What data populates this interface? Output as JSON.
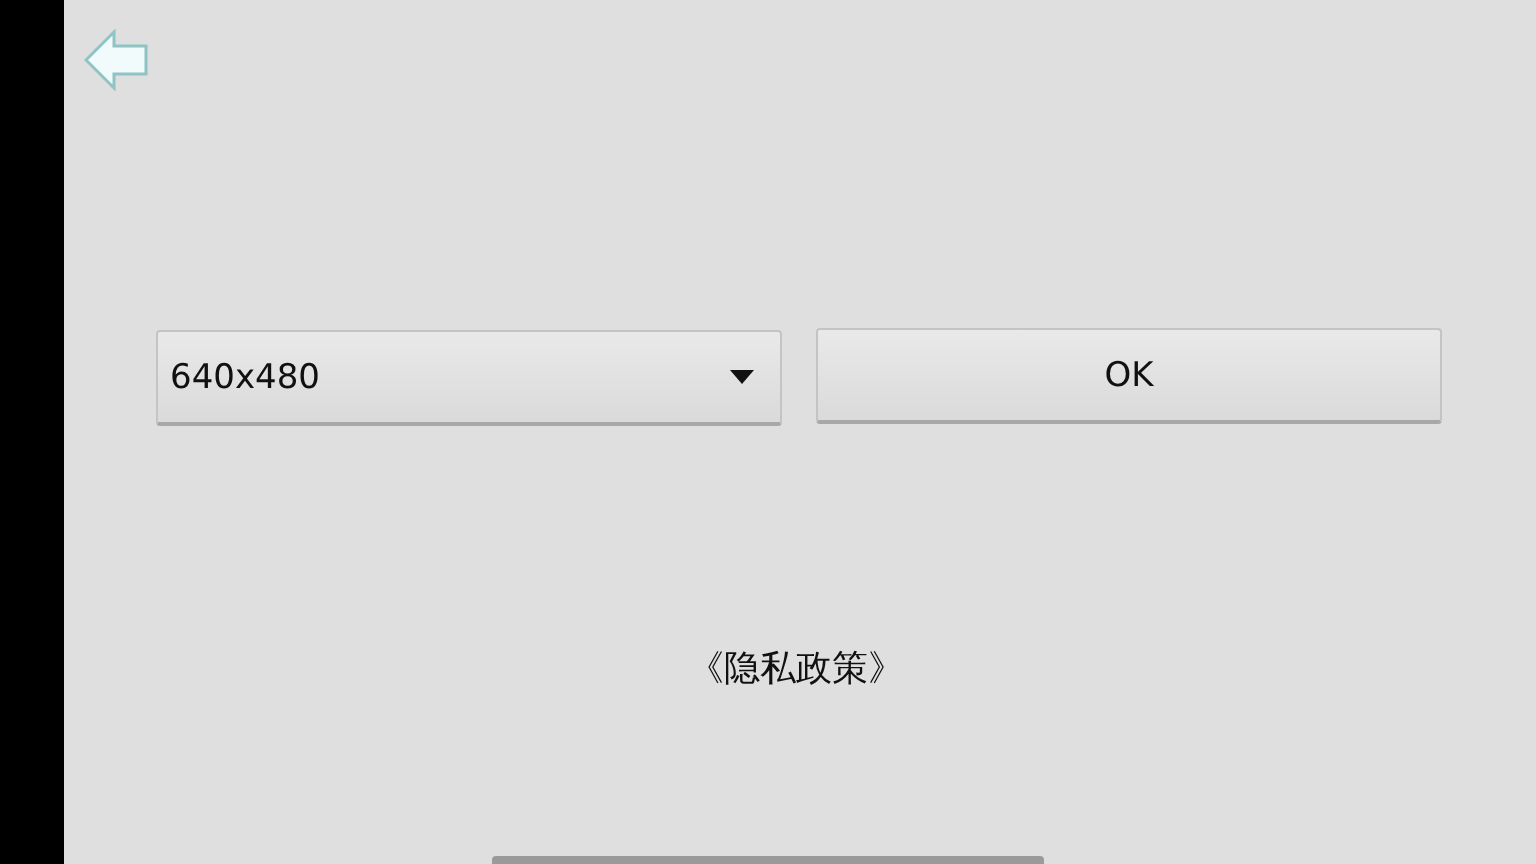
{
  "resolution_dropdown": {
    "value": "640x480"
  },
  "ok_button": {
    "label": "OK"
  },
  "privacy_link": {
    "label": "《隐私政策》"
  }
}
